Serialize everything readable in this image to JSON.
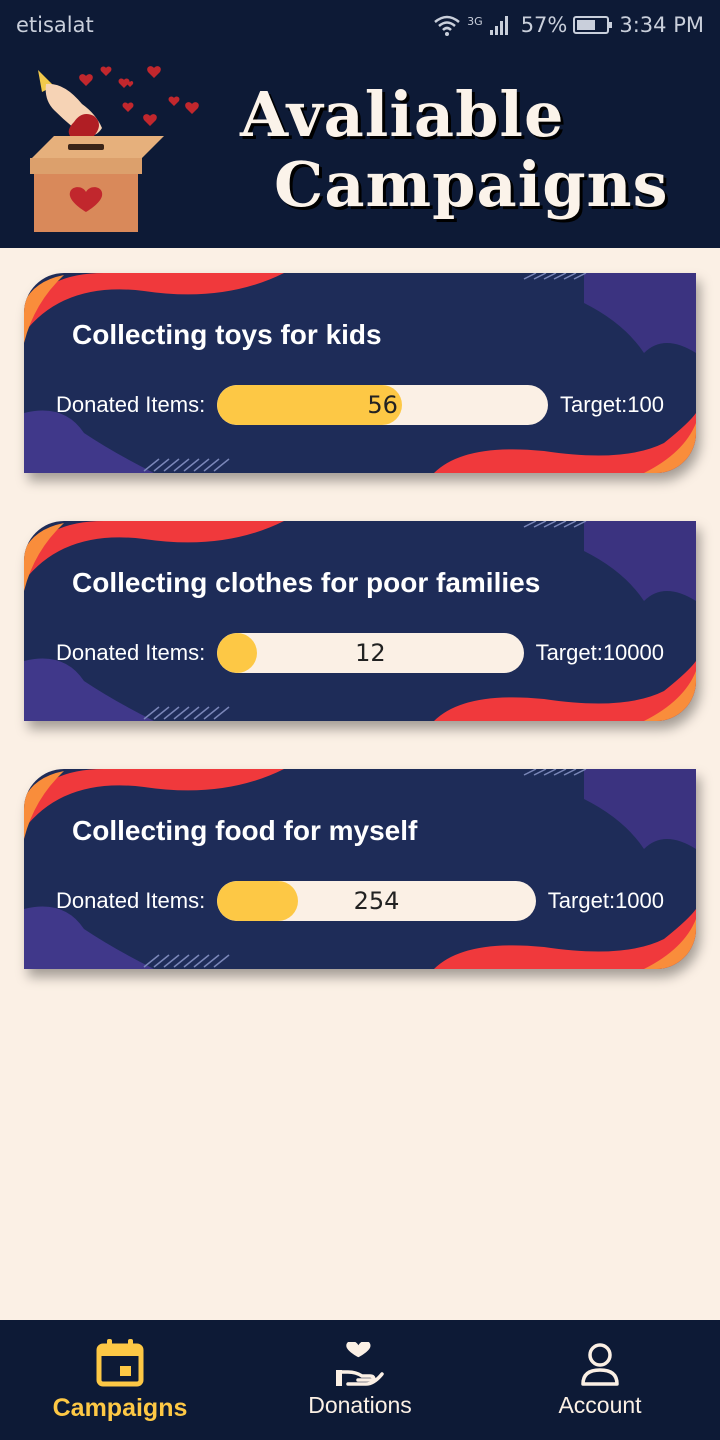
{
  "status_bar": {
    "carrier": "etisalat",
    "network": "3G",
    "battery": "57%",
    "time": "3:34 PM"
  },
  "header": {
    "title_line1": "Avaliable",
    "title_line2": "Campaigns"
  },
  "campaigns": [
    {
      "title": "Collecting toys for kids",
      "donated_label": "Donated Items:",
      "donated": 56,
      "target": 100,
      "progress": 0.56,
      "target_text": "Target:100"
    },
    {
      "title": "Collecting clothes for poor families",
      "donated_label": "Donated Items:",
      "donated": 12,
      "target": 10000,
      "progress": 0.0012,
      "target_text": "Target:10000"
    },
    {
      "title": "Collecting food for myself",
      "donated_label": "Donated Items:",
      "donated": 254,
      "target": 1000,
      "progress": 0.254,
      "target_text": "Target:1000"
    }
  ],
  "nav": {
    "items": [
      {
        "label": "Campaigns",
        "icon": "calendar-icon",
        "active": true
      },
      {
        "label": "Donations",
        "icon": "donate-hand-icon",
        "active": false
      },
      {
        "label": "Account",
        "icon": "user-icon",
        "active": false
      }
    ]
  },
  "colors": {
    "dark_navy": "#0d1a36",
    "card_navy": "#1e2c58",
    "cream": "#fbf0e5",
    "accent_yellow": "#fdc845",
    "accent_red": "#f0393c",
    "accent_orange": "#f98d3b",
    "accent_purple": "#4a3a8a"
  }
}
